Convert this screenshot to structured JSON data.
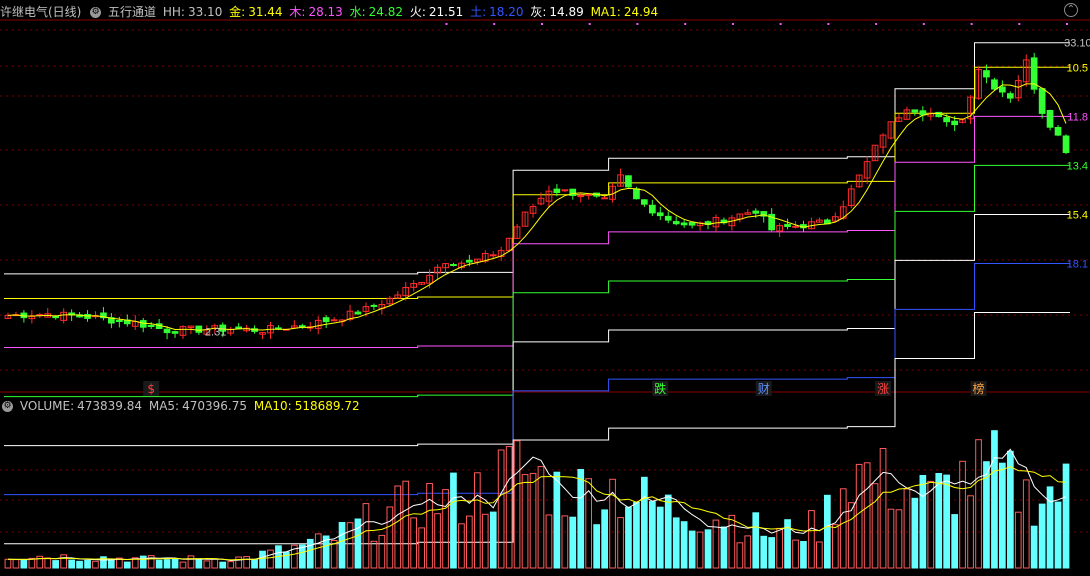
{
  "header": {
    "stock_name": "许继电气(日线)",
    "indicator_name": "五行通道",
    "hh": {
      "label": "HH:",
      "value": "33.10",
      "color": "#c0c0c0"
    },
    "metal": {
      "label": "金:",
      "value": "31.44",
      "color": "#ffff00"
    },
    "wood": {
      "label": "木:",
      "value": "28.13",
      "color": "#ff55ff"
    },
    "water": {
      "label": "水:",
      "value": "24.82",
      "color": "#33ff33"
    },
    "fire": {
      "label": "火:",
      "value": "21.51",
      "color": "#ffffff"
    },
    "earth": {
      "label": "土:",
      "value": "18.20",
      "color": "#3355ff"
    },
    "ash": {
      "label": "灰:",
      "value": "14.89",
      "color": "#ffffff"
    },
    "ma1": {
      "label": "MA1:",
      "value": "24.94",
      "color": "#ffff00"
    }
  },
  "volume_header": {
    "volume": {
      "label": "VOLUME:",
      "value": "473839.84",
      "color": "#c0c0c0"
    },
    "ma5": {
      "label": "MA5:",
      "value": "470396.75",
      "color": "#c0c0c0"
    },
    "ma10": {
      "label": "MA10:",
      "value": "518689.72",
      "color": "#ffff00"
    }
  },
  "colors": {
    "up": "#ff2a2a",
    "down": "#33ff33",
    "vol_up": "#ff5a5a",
    "vol_down": "#66ffff",
    "grid": "#7a0000",
    "hh_line": "#ffffff",
    "metal_line": "#ffff00",
    "wood_line": "#ff55ff",
    "water_line": "#33ff33",
    "fire_line": "#ffffff",
    "earth_line": "#3355ff",
    "ash_line": "#ffffff"
  },
  "chart_data": {
    "type": "candlestick",
    "price_range": [
      10.0,
      34.5
    ],
    "volume_range": [
      0,
      900000
    ],
    "right_axis_labels": [
      {
        "text": "10.5",
        "value": 31.44,
        "color": "#ffff00"
      },
      {
        "text": "11.8",
        "value": 28.13,
        "color": "#ff55ff"
      },
      {
        "text": "13.4",
        "value": 24.82,
        "color": "#33ff33"
      },
      {
        "text": "15.4",
        "value": 21.51,
        "color": "#ffff00"
      },
      {
        "text": "18.1",
        "value": 18.2,
        "color": "#3355ff"
      }
    ],
    "annotations": [
      {
        "text": "33.10",
        "value": 33.1,
        "index": 132,
        "color": "#c0c0c0"
      },
      {
        "text": "2.31",
        "value": 13.6,
        "index": 24,
        "color": "#c0c0c0"
      }
    ],
    "signals": [
      {
        "text": "$",
        "index": 18,
        "color": "#ff4040"
      },
      {
        "text": "跌",
        "index": 82,
        "color": "#33ff33"
      },
      {
        "text": "财",
        "index": 95,
        "color": "#5f8fff"
      },
      {
        "text": "涨",
        "index": 110,
        "color": "#ff4040"
      },
      {
        "text": "榜",
        "index": 122,
        "color": "#ffa040"
      }
    ],
    "close_points": [
      {
        "i": 0,
        "v": 14.7
      },
      {
        "i": 5,
        "v": 14.8
      },
      {
        "i": 10,
        "v": 14.6
      },
      {
        "i": 16,
        "v": 14.2
      },
      {
        "i": 20,
        "v": 13.7
      },
      {
        "i": 28,
        "v": 13.8
      },
      {
        "i": 32,
        "v": 13.7
      },
      {
        "i": 38,
        "v": 14.1
      },
      {
        "i": 42,
        "v": 14.6
      },
      {
        "i": 45,
        "v": 15.1
      },
      {
        "i": 48,
        "v": 15.8
      },
      {
        "i": 52,
        "v": 17.1
      },
      {
        "i": 55,
        "v": 18.4
      },
      {
        "i": 58,
        "v": 18.2
      },
      {
        "i": 62,
        "v": 19.1
      },
      {
        "i": 65,
        "v": 21.5
      },
      {
        "i": 68,
        "v": 23.2
      },
      {
        "i": 72,
        "v": 22.9
      },
      {
        "i": 75,
        "v": 22.4
      },
      {
        "i": 77,
        "v": 24.0
      },
      {
        "i": 79,
        "v": 22.5
      },
      {
        "i": 83,
        "v": 21.2
      },
      {
        "i": 86,
        "v": 20.7
      },
      {
        "i": 90,
        "v": 21.2
      },
      {
        "i": 94,
        "v": 21.8
      },
      {
        "i": 96,
        "v": 20.5
      },
      {
        "i": 100,
        "v": 20.8
      },
      {
        "i": 103,
        "v": 21.0
      },
      {
        "i": 105,
        "v": 22.2
      },
      {
        "i": 108,
        "v": 25.0
      },
      {
        "i": 110,
        "v": 27.0
      },
      {
        "i": 113,
        "v": 28.8
      },
      {
        "i": 116,
        "v": 28.3
      },
      {
        "i": 118,
        "v": 27.6
      },
      {
        "i": 120,
        "v": 27.9
      },
      {
        "i": 122,
        "v": 31.4
      },
      {
        "i": 124,
        "v": 30.2
      },
      {
        "i": 126,
        "v": 29.5
      },
      {
        "i": 128,
        "v": 31.8
      },
      {
        "i": 130,
        "v": 28.5
      },
      {
        "i": 132,
        "v": 26.8
      },
      {
        "i": 133,
        "v": 25.9
      }
    ],
    "volume_points": [
      {
        "i": 0,
        "v": 75000
      },
      {
        "i": 10,
        "v": 65000
      },
      {
        "i": 20,
        "v": 50000
      },
      {
        "i": 30,
        "v": 60000
      },
      {
        "i": 40,
        "v": 160000
      },
      {
        "i": 45,
        "v": 270000
      },
      {
        "i": 52,
        "v": 400000
      },
      {
        "i": 58,
        "v": 420000
      },
      {
        "i": 64,
        "v": 600000
      },
      {
        "i": 70,
        "v": 450000
      },
      {
        "i": 76,
        "v": 480000
      },
      {
        "i": 82,
        "v": 360000
      },
      {
        "i": 90,
        "v": 310000
      },
      {
        "i": 96,
        "v": 200000
      },
      {
        "i": 102,
        "v": 250000
      },
      {
        "i": 106,
        "v": 600000
      },
      {
        "i": 110,
        "v": 520000
      },
      {
        "i": 116,
        "v": 420000
      },
      {
        "i": 120,
        "v": 530000
      },
      {
        "i": 124,
        "v": 580000
      },
      {
        "i": 128,
        "v": 430000
      },
      {
        "i": 133,
        "v": 470000
      }
    ],
    "bar_count": 134,
    "channel_steps": [
      {
        "i": 0,
        "hh": 17.5
      },
      {
        "i": 52,
        "hh": 17.6
      },
      {
        "i": 64,
        "hh": 24.5
      },
      {
        "i": 76,
        "hh": 25.3
      },
      {
        "i": 106,
        "hh": 25.4
      },
      {
        "i": 112,
        "hh": 30.0
      },
      {
        "i": 122,
        "hh": 33.1
      }
    ],
    "channel_offsets": {
      "metal": 1.66,
      "wood": 4.97,
      "water": 8.28,
      "fire": 11.59,
      "earth": 14.9,
      "ash": 18.21
    }
  }
}
